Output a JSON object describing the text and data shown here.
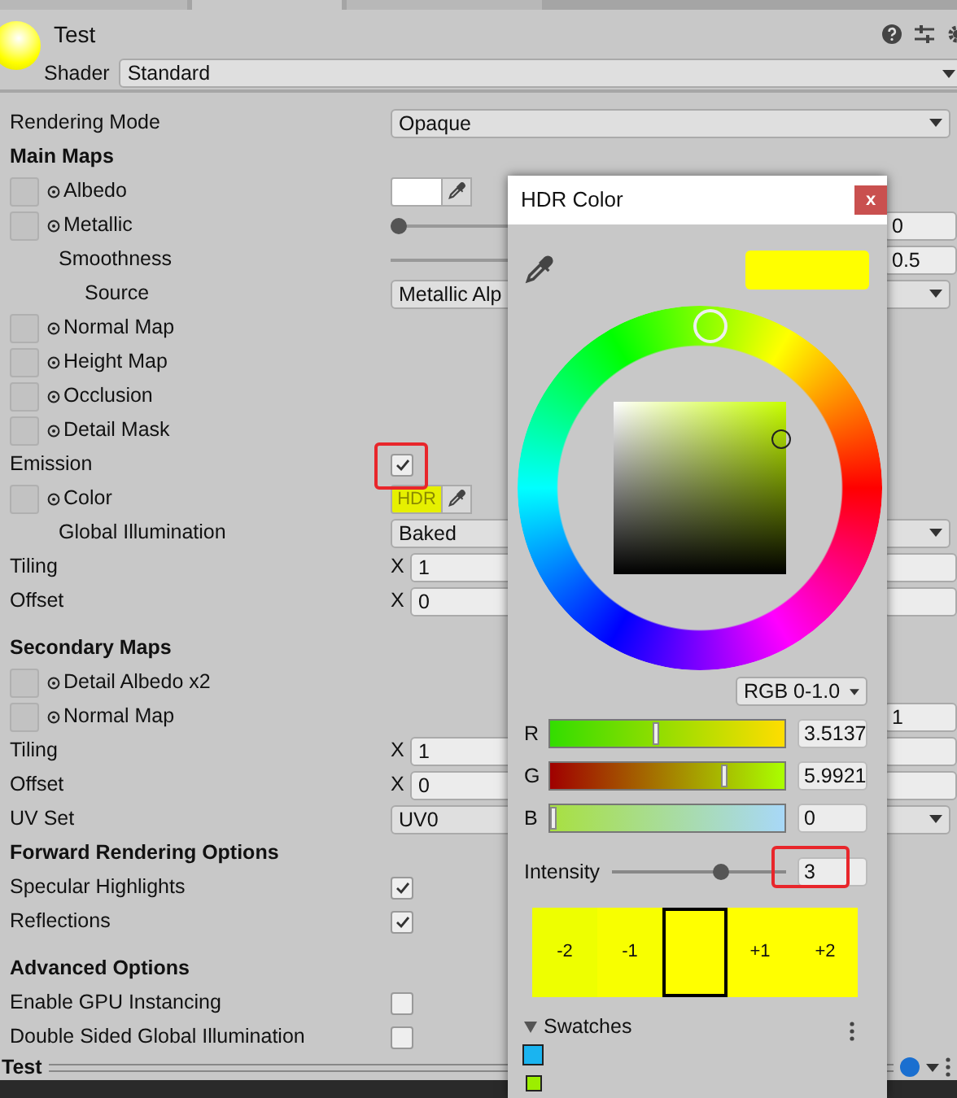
{
  "tabs": [
    {
      "selected": false
    },
    {
      "selected": true
    },
    {
      "selected": false
    }
  ],
  "header": {
    "title": "Test",
    "shader_label": "Shader",
    "shader": "Standard"
  },
  "rows": [
    {
      "kind": "dropdown",
      "label": "Rendering Mode",
      "value": "Opaque"
    },
    {
      "kind": "heading",
      "label": "Main Maps"
    },
    {
      "kind": "texture",
      "label": "Albedo",
      "color": "#ffffff"
    },
    {
      "kind": "texture",
      "label": "Metallic",
      "level": 0,
      "value": "0",
      "children": [
        {
          "kind": "slider",
          "label": "Smoothness",
          "value": "0.5",
          "children": [
            {
              "kind": "dropdown",
              "label": "Source",
              "value": "Metallic Alp"
            }
          ]
        }
      ]
    },
    {
      "kind": "texture",
      "label": "Normal Map"
    },
    {
      "kind": "texture",
      "label": "Height Map"
    },
    {
      "kind": "texture",
      "label": "Occlusion"
    },
    {
      "kind": "texture",
      "label": "Detail Mask"
    },
    {
      "kind": "checkbox",
      "label": "Emission",
      "checked": true,
      "highlighted": true
    },
    {
      "kind": "texture",
      "label": "Color",
      "color": "#e6f000",
      "badge": "HDR",
      "children": [
        {
          "kind": "dropdown",
          "label": "Global Illumination",
          "value": "Baked"
        }
      ]
    },
    {
      "kind": "vector",
      "label": "Tiling",
      "axis": "X",
      "value": "1"
    },
    {
      "kind": "vector",
      "label": "Offset",
      "axis": "X",
      "value": "0"
    },
    {
      "kind": "spacer"
    },
    {
      "kind": "heading",
      "label": "Secondary Maps"
    },
    {
      "kind": "texture",
      "label": "Detail Albedo x2"
    },
    {
      "kind": "texture",
      "label": "Normal Map",
      "value": "1"
    },
    {
      "kind": "vector",
      "label": "Tiling",
      "axis": "X",
      "value": "1"
    },
    {
      "kind": "vector",
      "label": "Offset",
      "axis": "X",
      "value": "0"
    },
    {
      "kind": "dropdown",
      "label": "UV Set",
      "value": "UV0"
    },
    {
      "kind": "heading",
      "label": "Forward Rendering Options"
    },
    {
      "kind": "checkbox",
      "label": "Specular Highlights",
      "checked": true
    },
    {
      "kind": "checkbox",
      "label": "Reflections",
      "checked": true
    },
    {
      "kind": "spacer"
    },
    {
      "kind": "heading",
      "label": "Advanced Options"
    },
    {
      "kind": "checkbox",
      "label": "Enable GPU Instancing",
      "checked": false
    },
    {
      "kind": "checkbox",
      "label": "Double Sided Global Illumination",
      "checked": false
    }
  ],
  "preview_bar": {
    "title": "Test"
  },
  "popup": {
    "title": "HDR Color",
    "close": "x",
    "mode": "RGB 0-1.0",
    "channels": [
      {
        "label": "R",
        "level": 0.45,
        "value": "3.5137"
      },
      {
        "label": "G",
        "level": 0.75,
        "value": "5.9921"
      },
      {
        "label": "B",
        "level": 0,
        "value": "0"
      }
    ],
    "intensity": {
      "label": "Intensity",
      "level": 0.64,
      "value": "3",
      "highlighted": true
    },
    "exposure": [
      {
        "label": "-2",
        "color": "#eeff00",
        "selected": false
      },
      {
        "label": "-1",
        "color": "#f8ff00",
        "selected": false
      },
      {
        "color": "#ffff00",
        "selected": true
      },
      {
        "label": "+1",
        "color": "#ffff00",
        "selected": false
      },
      {
        "label": "+2",
        "color": "#ffff00",
        "selected": false
      }
    ],
    "swatches_label": "Swatches",
    "swatches_expanded": true,
    "swatches": [
      {
        "color": "#1ab4f0"
      },
      {
        "color": "#9cee00"
      }
    ]
  }
}
